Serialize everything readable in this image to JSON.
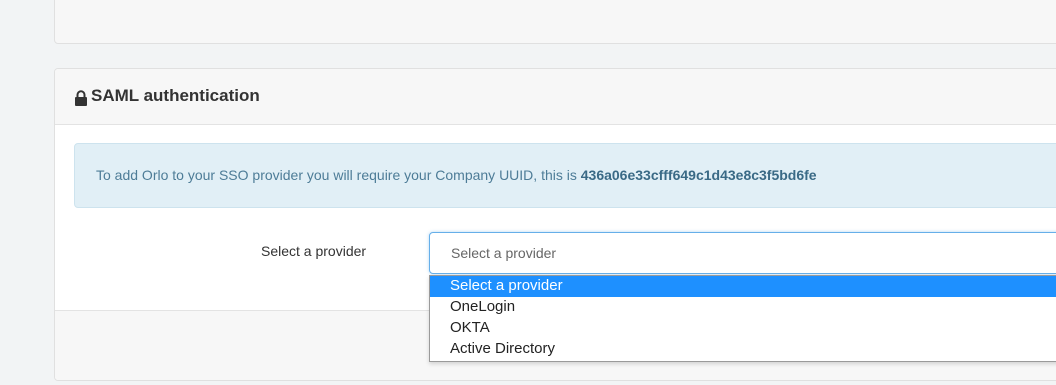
{
  "saml_panel": {
    "title": "SAML authentication",
    "lock_icon": "lock-icon",
    "info_text": "To add Orlo to your SSO provider you will require your Company UUID, this is ",
    "company_uuid": "436a06e33cfff649c1d43e8c3f5bd6fe",
    "provider_label": "Select a provider",
    "provider_select": {
      "selected_value": "Select a provider",
      "options": [
        "Select a provider",
        "OneLogin",
        "OKTA",
        "Active Directory"
      ],
      "highlighted_option": "Select a provider"
    }
  },
  "colors": {
    "page_background": "#f2f4f5",
    "info_background": "#e1eff6",
    "info_text": "#4d7c97",
    "highlight": "#1e90ff",
    "focus_border": "#66afe9"
  }
}
